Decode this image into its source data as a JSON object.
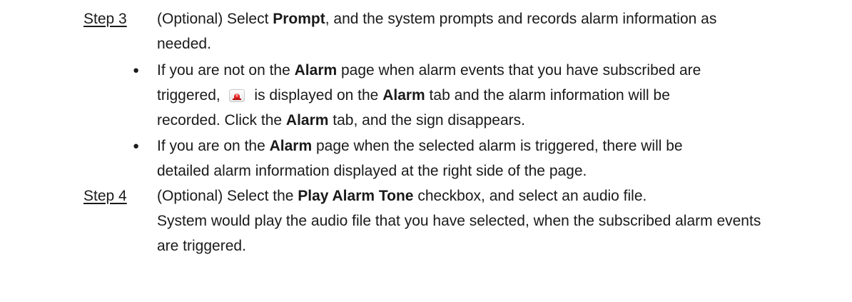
{
  "step3": {
    "label": "Step 3",
    "line1_pre": "(Optional) Select ",
    "line1_bold": "Prompt",
    "line1_post": ", and the system prompts and records alarm information as",
    "line2": "needed.",
    "bullet1": {
      "l1_pre": "If you are not on the ",
      "l1_bold": "Alarm",
      "l1_post": " page when alarm events that you have subscribed are",
      "l2_pre": "triggered, ",
      "l2_icon": "alarm-siren-icon",
      "l2_mid": " is displayed on the ",
      "l2_bold": "Alarm",
      "l2_post": " tab and the alarm information will be",
      "l3_pre": "recorded. Click the ",
      "l3_bold": "Alarm",
      "l3_post": " tab, and the sign disappears."
    },
    "bullet2": {
      "l1_pre": "If you are on the ",
      "l1_bold": "Alarm",
      "l1_post": " page when the selected alarm is triggered, there will be",
      "l2": "detailed alarm information displayed at the right side of the page."
    }
  },
  "step4": {
    "label": "Step 4",
    "line1_pre": "(Optional) Select the ",
    "line1_bold": "Play Alarm Tone",
    "line1_post": " checkbox, and select an audio file.",
    "line2": "System would play the audio file that you have selected, when the subscribed alarm events",
    "line3": "are triggered."
  },
  "bullet_glyph": "●"
}
